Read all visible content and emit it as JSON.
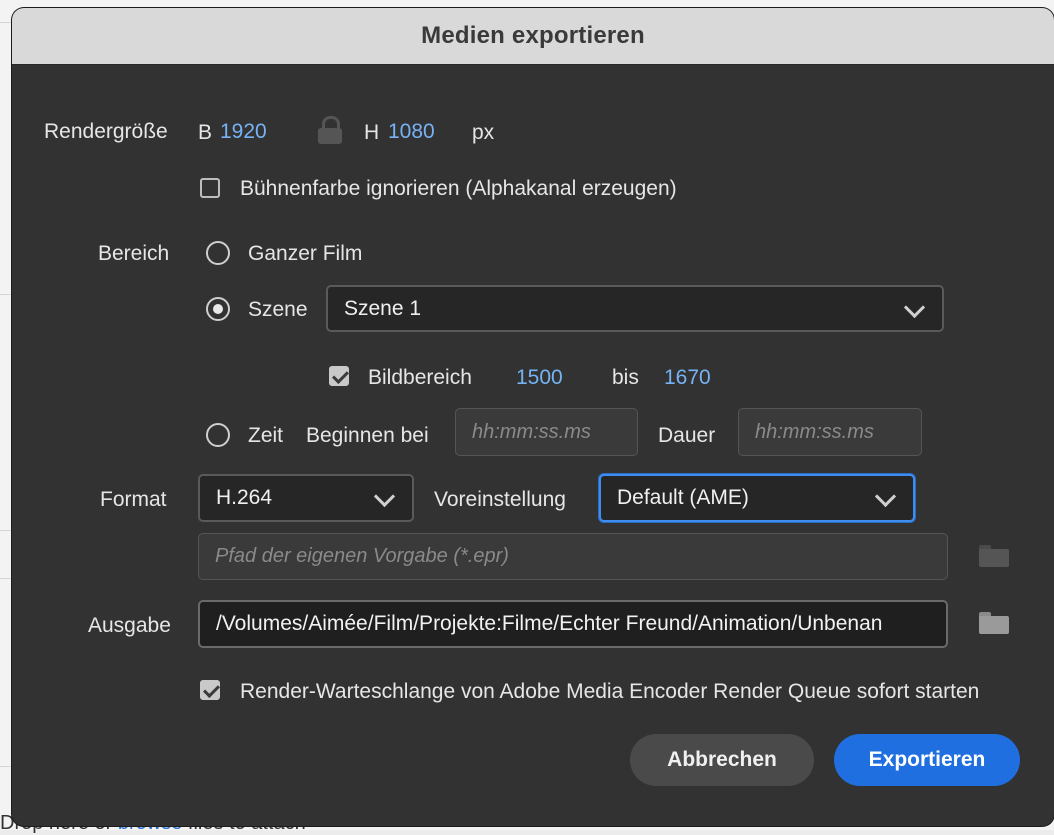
{
  "background": {
    "bottom_text_prefix": "Drop here or ",
    "bottom_text_link": "browse",
    "bottom_text_suffix": " files to attach"
  },
  "dialog": {
    "title": "Medien exportieren",
    "render_size": {
      "label": "Rendergröße",
      "width_label": "B",
      "width_value": "1920",
      "height_label": "H",
      "height_value": "1080",
      "unit": "px",
      "lock_icon": "lock-icon"
    },
    "ignore_stage_color": {
      "label": "Bühnenfarbe ignorieren (Alphakanal erzeugen)",
      "checked": false
    },
    "range": {
      "label": "Bereich",
      "whole_movie_label": "Ganzer Film",
      "scene_label": "Szene",
      "scene_selected": "Szene 1",
      "frame_range": {
        "label": "Bildbereich",
        "checked": true,
        "from": "1500",
        "to_label": "bis",
        "to": "1670"
      },
      "time": {
        "label": "Zeit",
        "start_label": "Beginnen bei",
        "start_placeholder": "hh:mm:ss.ms",
        "duration_label": "Dauer",
        "duration_placeholder": "hh:mm:ss.ms"
      },
      "selected_option": "Szene"
    },
    "format": {
      "label": "Format",
      "value": "H.264",
      "preset_label": "Voreinstellung",
      "preset_value": "Default (AME)",
      "custom_preset_placeholder": "Pfad der eigenen Vorgabe (*.epr)"
    },
    "output": {
      "label": "Ausgabe",
      "path": "/Volumes/Aimée/Film/Projekte:Filme/Echter Freund/Animation/Unbenan"
    },
    "start_queue": {
      "label": "Render-Warteschlange von Adobe Media Encoder Render Queue sofort starten",
      "checked": true
    },
    "buttons": {
      "cancel": "Abbrechen",
      "export": "Exportieren"
    },
    "colors": {
      "accent": "#1f6fe0",
      "value_blue": "#76b3f4",
      "focus": "#3d8ef0"
    }
  }
}
